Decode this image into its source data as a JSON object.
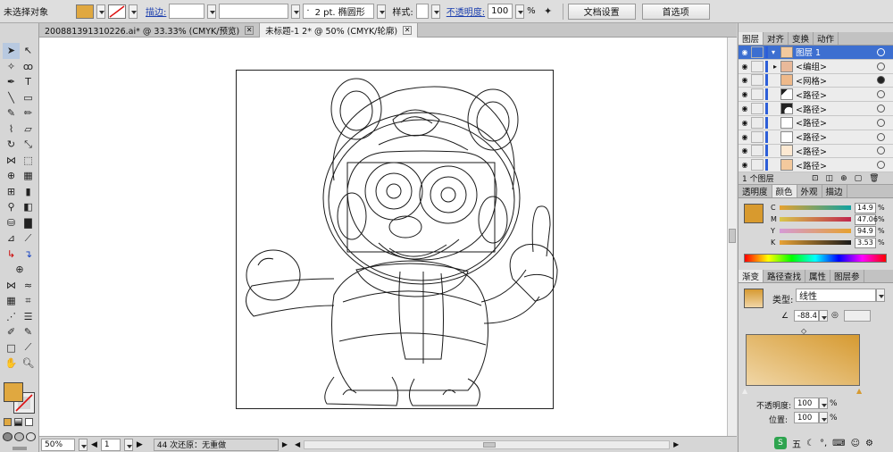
{
  "control": {
    "selection": "未选择对象",
    "stroke_label": "描边:",
    "stroke_weight": "·",
    "brush": "2 pt. 椭圆形",
    "style_label": "样式:",
    "opacity_label": "不透明度:",
    "opacity_value": "100",
    "percent": "%",
    "doc_setup": "文档设置",
    "prefs": "首选项"
  },
  "tabs": [
    {
      "label": "200881391310226.ai* @ 33.33% (CMYK/预览)"
    },
    {
      "label": "未标题-1 2* @ 50% (CMYK/轮廓)"
    }
  ],
  "status": {
    "zoom": "50%",
    "page": "1",
    "info": "44 次还原：无重做"
  },
  "layers_panel": {
    "tabs": [
      "图层",
      "对齐",
      "变换",
      "动作"
    ],
    "rows": [
      {
        "name": "图层 1"
      },
      {
        "name": "<编组>"
      },
      {
        "name": "<网格>"
      },
      {
        "name": "<路径>"
      },
      {
        "name": "<路径>"
      },
      {
        "name": "<路径>"
      },
      {
        "name": "<路径>"
      },
      {
        "name": "<路径>"
      },
      {
        "name": "<路径>"
      }
    ],
    "footer": "1 个图层"
  },
  "color_panel": {
    "tabs": [
      "透明度",
      "颜色",
      "外观",
      "描边"
    ],
    "channels": [
      {
        "ch": "C",
        "value": "14.9"
      },
      {
        "ch": "M",
        "value": "47.06"
      },
      {
        "ch": "Y",
        "value": "94.9"
      },
      {
        "ch": "K",
        "value": "3.53"
      }
    ],
    "swatch": "#d89a2e"
  },
  "gradient_panel": {
    "tabs": [
      "渐变",
      "路径查找",
      "属性",
      "图层参"
    ],
    "type_label": "类型:",
    "type_value": "线性",
    "angle": "-88.4",
    "opacity_label": "不透明度:",
    "opacity_value": "100",
    "position_label": "位置:",
    "position_value": "100"
  },
  "taskbar": {
    "ime": "五"
  },
  "colors": {
    "fill": "#e0a840",
    "gradient_start": "#f0d6a6",
    "gradient_end": "#d69a31",
    "selection_blue": "#3d6fd0"
  }
}
